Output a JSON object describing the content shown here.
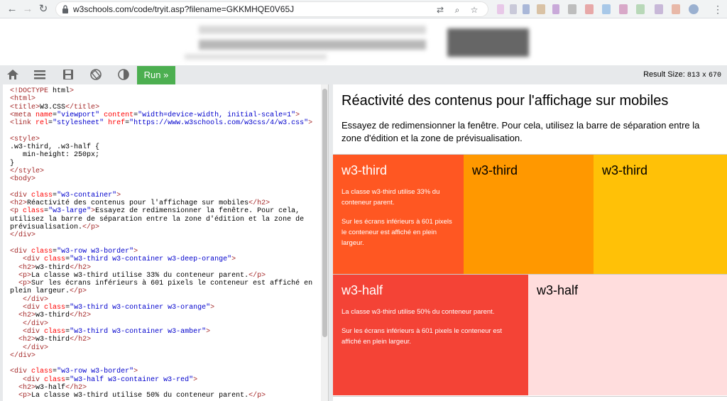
{
  "browser": {
    "url": "w3schools.com/code/tryit.asp?filename=GKKMHQE0V65J"
  },
  "toolbar": {
    "run_label": "Run »",
    "result_size_label": "Result Size:",
    "result_width": "813",
    "result_x": "x",
    "result_height": "670"
  },
  "code": {
    "lines": [
      "<!DOCTYPE html>",
      "<html>",
      "<title>W3.CSS</title>",
      "<meta name=\"viewport\" content=\"width=device-width, initial-scale=1\">",
      "<link rel=\"stylesheet\" href=\"https://www.w3schools.com/w3css/4/w3.css\">",
      "",
      "<style>",
      ".w3-third, .w3-half {",
      "   min-height: 250px;",
      "}",
      "</style>",
      "<body>",
      "",
      "<div class=\"w3-container\">",
      "<h2>Réactivité des contenus pour l'affichage sur mobiles</h2>",
      "<p class=\"w3-large\">Essayez de redimensionner la fenêtre. Pour cela,",
      "utilisez la barre de séparation entre la zone d'édition et la zone de",
      "prévisualisation.</p>",
      "</div>",
      "",
      "<div class=\"w3-row w3-border\">",
      "   <div class=\"w3-third w3-container w3-deep-orange\">",
      "  <h2>w3-third</h2>",
      "  <p>La classe w3-third utilise 33% du conteneur parent.</p>",
      "  <p>Sur les écrans inférieurs à 601 pixels le conteneur est affiché en",
      "plein largeur.</p>",
      "   </div>",
      "   <div class=\"w3-third w3-container w3-orange\">",
      "  <h2>w3-third</h2>",
      "   </div>",
      "   <div class=\"w3-third w3-container w3-amber\">",
      "  <h2>w3-third</h2>",
      "   </div>",
      "</div>",
      "",
      "<div class=\"w3-row w3-border\">",
      "   <div class=\"w3-half w3-container w3-red\">",
      "  <h2>w3-half</h2>",
      "  <p>La classe w3-third utilise 50% du conteneur parent.</p>"
    ]
  },
  "preview": {
    "title": "Réactivité des contenus pour l'affichage sur mobiles",
    "lead": "Essayez de redimensionner la fenêtre. Pour cela, utilisez la barre de séparation entre la zone d'édition et la zone de prévisualisation.",
    "row1": [
      {
        "heading": "w3-third",
        "p1": "La classe w3-third utilise 33% du conteneur parent.",
        "p2": "Sur les écrans inférieurs à 601 pixels le conteneur est affiché en plein largeur.",
        "color": "#ff5722",
        "text_color": "#ffffff"
      },
      {
        "heading": "w3-third",
        "color": "#ff9800",
        "text_color": "#000000"
      },
      {
        "heading": "w3-third",
        "color": "#ffc107",
        "text_color": "#000000"
      }
    ],
    "row2": [
      {
        "heading": "w3-half",
        "p1": "La classe w3-third utilise 50% du conteneur parent.",
        "p2": "Sur les écrans inférieurs à 601 pixels le conteneur est affiché en plein largeur.",
        "color": "#f44336",
        "text_color": "#ffffff"
      },
      {
        "heading": "w3-half",
        "color": "#ffdddd",
        "text_color": "#000000"
      }
    ]
  },
  "icons": {
    "back": "arrow-left-icon",
    "forward": "arrow-right-icon",
    "reload": "reload-icon",
    "home": "home-icon",
    "menu": "menu-icon",
    "save": "save-icon",
    "rotate": "rotate-icon",
    "theme": "contrast-icon"
  }
}
